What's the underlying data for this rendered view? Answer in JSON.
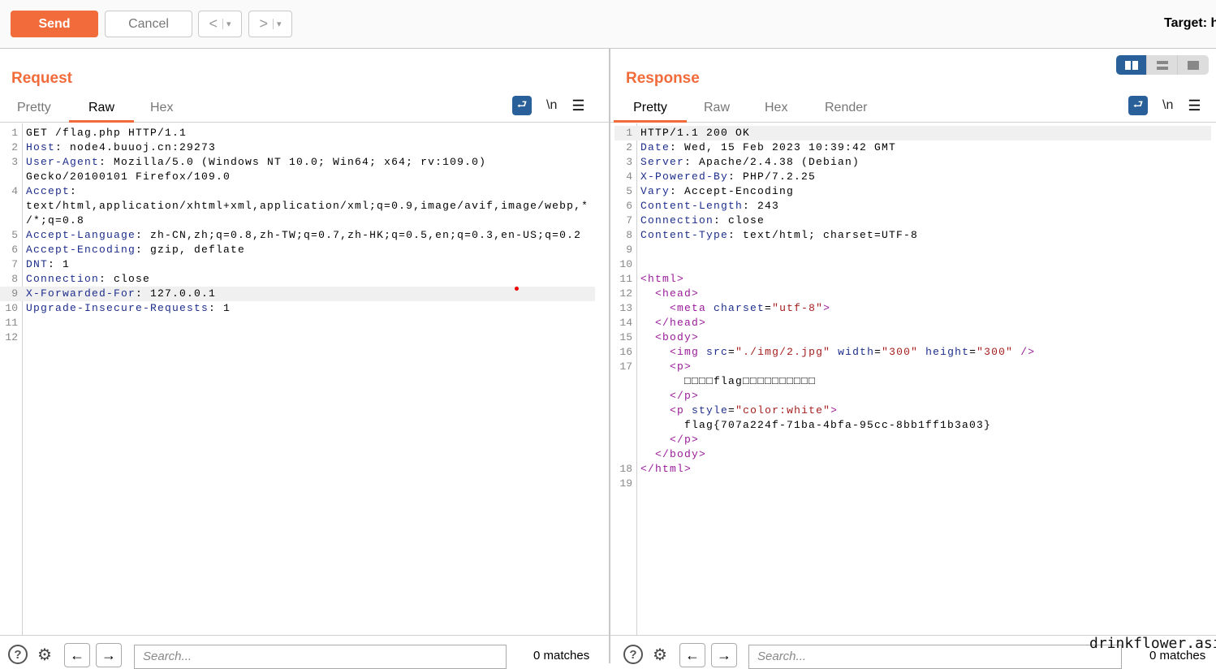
{
  "toolbar": {
    "send": "Send",
    "cancel": "Cancel",
    "back": "<",
    "forward": ">",
    "dropdown": "▾",
    "target": "Target: h"
  },
  "request": {
    "title": "Request",
    "tabs": [
      "Pretty",
      "Raw",
      "Hex"
    ],
    "active_tab": "Raw",
    "newline_label": "\\n",
    "rows": [
      {
        "n": "1",
        "s": [
          [
            "plain",
            "GET /flag.php HTTP/1.1"
          ]
        ]
      },
      {
        "n": "2",
        "s": [
          [
            "key",
            "Host"
          ],
          [
            "plain",
            ": node4.buuoj.cn:29273"
          ]
        ]
      },
      {
        "n": "3",
        "s": [
          [
            "key",
            "User-Agent"
          ],
          [
            "plain",
            ": Mozilla/5.0 (Windows NT 10.0; Win64; x64; rv:109.0)"
          ]
        ]
      },
      {
        "n": "",
        "s": [
          [
            "plain",
            "Gecko/20100101 Firefox/109.0"
          ]
        ]
      },
      {
        "n": "4",
        "s": [
          [
            "key",
            "Accept"
          ],
          [
            "plain",
            ":"
          ]
        ]
      },
      {
        "n": "",
        "s": [
          [
            "plain",
            "text/html,application/xhtml+xml,application/xml;q=0.9,image/avif,image/webp,*"
          ]
        ]
      },
      {
        "n": "",
        "s": [
          [
            "plain",
            "/*;q=0.8"
          ]
        ]
      },
      {
        "n": "5",
        "s": [
          [
            "key",
            "Accept-Language"
          ],
          [
            "plain",
            ": zh-CN,zh;q=0.8,zh-TW;q=0.7,zh-HK;q=0.5,en;q=0.3,en-US;q=0.2"
          ]
        ]
      },
      {
        "n": "6",
        "s": [
          [
            "key",
            "Accept-Encoding"
          ],
          [
            "plain",
            ": gzip, deflate"
          ]
        ]
      },
      {
        "n": "7",
        "s": [
          [
            "key",
            "DNT"
          ],
          [
            "plain",
            ": 1"
          ]
        ]
      },
      {
        "n": "8",
        "s": [
          [
            "key",
            "Connection"
          ],
          [
            "plain",
            ": close"
          ]
        ]
      },
      {
        "n": "9",
        "s": [
          [
            "key",
            "X-Forwarded-For"
          ],
          [
            "plain",
            ": 127.0.0.1"
          ]
        ],
        "hl": true
      },
      {
        "n": "10",
        "s": [
          [
            "key",
            "Upgrade-Insecure-Requests"
          ],
          [
            "plain",
            ": 1"
          ]
        ]
      },
      {
        "n": "11",
        "s": []
      },
      {
        "n": "12",
        "s": []
      }
    ],
    "search_placeholder": "Search...",
    "matches": "0 matches"
  },
  "response": {
    "title": "Response",
    "tabs": [
      "Pretty",
      "Raw",
      "Hex",
      "Render"
    ],
    "active_tab": "Pretty",
    "newline_label": "\\n",
    "rows": [
      {
        "n": "1",
        "s": [
          [
            "plain",
            "HTTP/1.1 200 OK"
          ]
        ],
        "hl": true
      },
      {
        "n": "2",
        "s": [
          [
            "key",
            "Date"
          ],
          [
            "plain",
            ": Wed, 15 Feb 2023 10:39:42 GMT"
          ]
        ]
      },
      {
        "n": "3",
        "s": [
          [
            "key",
            "Server"
          ],
          [
            "plain",
            ": Apache/2.4.38 (Debian)"
          ]
        ]
      },
      {
        "n": "4",
        "s": [
          [
            "key",
            "X-Powered-By"
          ],
          [
            "plain",
            ": PHP/7.2.25"
          ]
        ]
      },
      {
        "n": "5",
        "s": [
          [
            "key",
            "Vary"
          ],
          [
            "plain",
            ": Accept-Encoding"
          ]
        ]
      },
      {
        "n": "6",
        "s": [
          [
            "key",
            "Content-Length"
          ],
          [
            "plain",
            ": 243"
          ]
        ]
      },
      {
        "n": "7",
        "s": [
          [
            "key",
            "Connection"
          ],
          [
            "plain",
            ": close"
          ]
        ]
      },
      {
        "n": "8",
        "s": [
          [
            "key",
            "Content-Type"
          ],
          [
            "plain",
            ": text/html; charset=UTF-8"
          ]
        ]
      },
      {
        "n": "9",
        "s": []
      },
      {
        "n": "10",
        "s": []
      },
      {
        "n": "11",
        "s": [
          [
            "tag",
            "<html>"
          ]
        ]
      },
      {
        "n": "12",
        "s": [
          [
            "plain",
            "  "
          ],
          [
            "tag",
            "<head>"
          ]
        ]
      },
      {
        "n": "13",
        "s": [
          [
            "plain",
            "    "
          ],
          [
            "tag",
            "<meta "
          ],
          [
            "attr",
            "charset"
          ],
          [
            "plain",
            "="
          ],
          [
            "val",
            "\"utf-8\""
          ],
          [
            "tag",
            ">"
          ]
        ]
      },
      {
        "n": "14",
        "s": [
          [
            "plain",
            "  "
          ],
          [
            "tag",
            "</head>"
          ]
        ]
      },
      {
        "n": "15",
        "s": [
          [
            "plain",
            "  "
          ],
          [
            "tag",
            "<body>"
          ]
        ]
      },
      {
        "n": "16",
        "s": [
          [
            "plain",
            "    "
          ],
          [
            "tag",
            "<img "
          ],
          [
            "attr",
            "src"
          ],
          [
            "plain",
            "="
          ],
          [
            "val",
            "\"./img/2.jpg\""
          ],
          [
            "attr",
            " width"
          ],
          [
            "plain",
            "="
          ],
          [
            "val",
            "\"300\""
          ],
          [
            "attr",
            " height"
          ],
          [
            "plain",
            "="
          ],
          [
            "val",
            "\"300\""
          ],
          [
            "tag",
            " />"
          ]
        ]
      },
      {
        "n": "17",
        "s": [
          [
            "plain",
            "    "
          ],
          [
            "tag",
            "<p>"
          ]
        ]
      },
      {
        "n": "",
        "s": [
          [
            "plain",
            "      □□□□flag□□□□□□□□□□"
          ]
        ]
      },
      {
        "n": "",
        "s": [
          [
            "plain",
            "    "
          ],
          [
            "tag",
            "</p>"
          ]
        ]
      },
      {
        "n": "",
        "s": [
          [
            "plain",
            "    "
          ],
          [
            "tag",
            "<p "
          ],
          [
            "attr",
            "style"
          ],
          [
            "plain",
            "="
          ],
          [
            "val",
            "\"color:white\""
          ],
          [
            "tag",
            ">"
          ]
        ]
      },
      {
        "n": "",
        "s": [
          [
            "plain",
            "      flag{707a224f-71ba-4bfa-95cc-8bb1ff1b3a03}"
          ]
        ]
      },
      {
        "n": "",
        "s": [
          [
            "plain",
            "    "
          ],
          [
            "tag",
            "</p>"
          ]
        ]
      },
      {
        "n": "",
        "s": [
          [
            "plain",
            "  "
          ],
          [
            "tag",
            "</body>"
          ]
        ]
      },
      {
        "n": "18",
        "s": [
          [
            "tag",
            "</html>"
          ]
        ]
      },
      {
        "n": "19",
        "s": []
      }
    ],
    "search_placeholder": "Search...",
    "matches": "0 matches"
  },
  "layout_modes": [
    "side-by-side",
    "top-bottom",
    "single"
  ],
  "active_layout": "side-by-side",
  "watermark": "drinkflower.asia",
  "colors": {
    "accent": "#f26b3a",
    "blue": "#2a6099"
  }
}
